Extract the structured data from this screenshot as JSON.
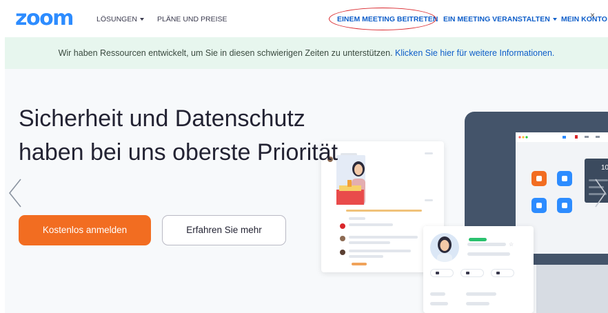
{
  "nav": {
    "logo": "zoom",
    "solutions": "LÖSUNGEN",
    "plans": "PLÄNE UND PREISE",
    "join_meeting": "EINEM MEETING BEITRETEN",
    "host_meeting": "EIN MEETING VERANSTALTEN",
    "my_account": "MEIN KONTO"
  },
  "banner": {
    "text": "Wir haben Ressourcen entwickelt, um Sie in diesen schwierigen Zeiten zu unterstützen.",
    "link": "Klicken Sie hier für weitere Informationen.",
    "close": "×"
  },
  "hero": {
    "headline": "Sicherheit und Datenschutz haben bei uns oberste Priorität",
    "primary_button": "Kostenlos anmelden",
    "secondary_button": "Erfahren Sie mehr"
  },
  "illustration": {
    "contact_panel_number": "10"
  },
  "colors": {
    "brand_blue": "#2d8cff",
    "link_blue": "#0e5ec9",
    "cta_orange": "#f26d21",
    "banner_green": "#e7f6ee",
    "annotation_red": "#d9262b"
  },
  "icons": {
    "prev_slide": "chevron-left-icon",
    "next_slide": "chevron-right-icon",
    "dropdown": "caret-down-icon",
    "close": "close-icon"
  }
}
